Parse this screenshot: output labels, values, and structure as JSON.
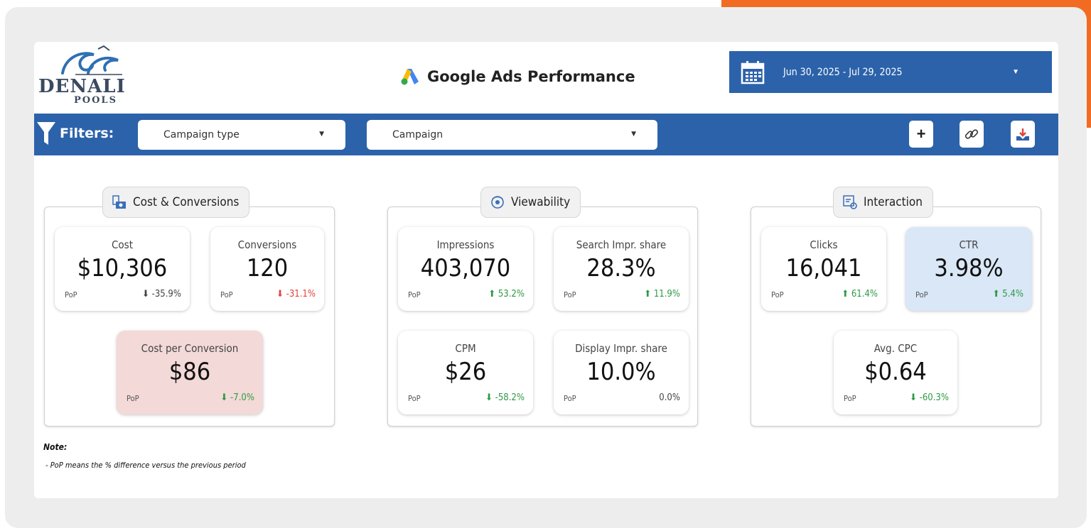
{
  "header": {
    "logo_text": "DENALI",
    "logo_sub": "POOLS",
    "title": "Google Ads Performance",
    "date_range": "Jun 30, 2025 - Jul 29, 2025"
  },
  "filters": {
    "label": "Filters:",
    "campaign_type": "Campaign type",
    "campaign": "Campaign"
  },
  "groups": {
    "cost": {
      "title": "Cost & Conversions",
      "metrics": [
        {
          "label": "Cost",
          "value": "$10,306",
          "pop": "PoP",
          "delta": "⬇ -35.9%"
        },
        {
          "label": "Conversions",
          "value": "120",
          "pop": "PoP",
          "delta": "⬇ -31.1%"
        },
        {
          "label": "Cost per Conversion",
          "value": "$86",
          "pop": "PoP",
          "delta": "⬇ -7.0%"
        }
      ]
    },
    "view": {
      "title": "Viewability",
      "metrics": [
        {
          "label": "Impressions",
          "value": "403,070",
          "pop": "PoP",
          "delta": "⬆ 53.2%"
        },
        {
          "label": "Search Impr. share",
          "value": "28.3%",
          "pop": "PoP",
          "delta": "⬆ 11.9%"
        },
        {
          "label": "CPM",
          "value": "$26",
          "pop": "PoP",
          "delta": "⬇ -58.2%"
        },
        {
          "label": "Display Impr. share",
          "value": "10.0%",
          "pop": "PoP",
          "delta": "0.0%"
        }
      ]
    },
    "interaction": {
      "title": "Interaction",
      "metrics": [
        {
          "label": "Clicks",
          "value": "16,041",
          "pop": "PoP",
          "delta": "⬆ 61.4%"
        },
        {
          "label": "CTR",
          "value": "3.98%",
          "pop": "PoP",
          "delta": "⬆ 5.4%"
        },
        {
          "label": "Avg. CPC",
          "value": "$0.64",
          "pop": "PoP",
          "delta": "⬇ -60.3%"
        }
      ]
    }
  },
  "note": {
    "heading": "Note:",
    "text": "- PoP means the % difference versus the previous period"
  },
  "colors": {
    "brand_blue": "#2c62aa",
    "orange": "#f26b22",
    "positive": "#2e9a45",
    "negative": "#e2433b"
  }
}
